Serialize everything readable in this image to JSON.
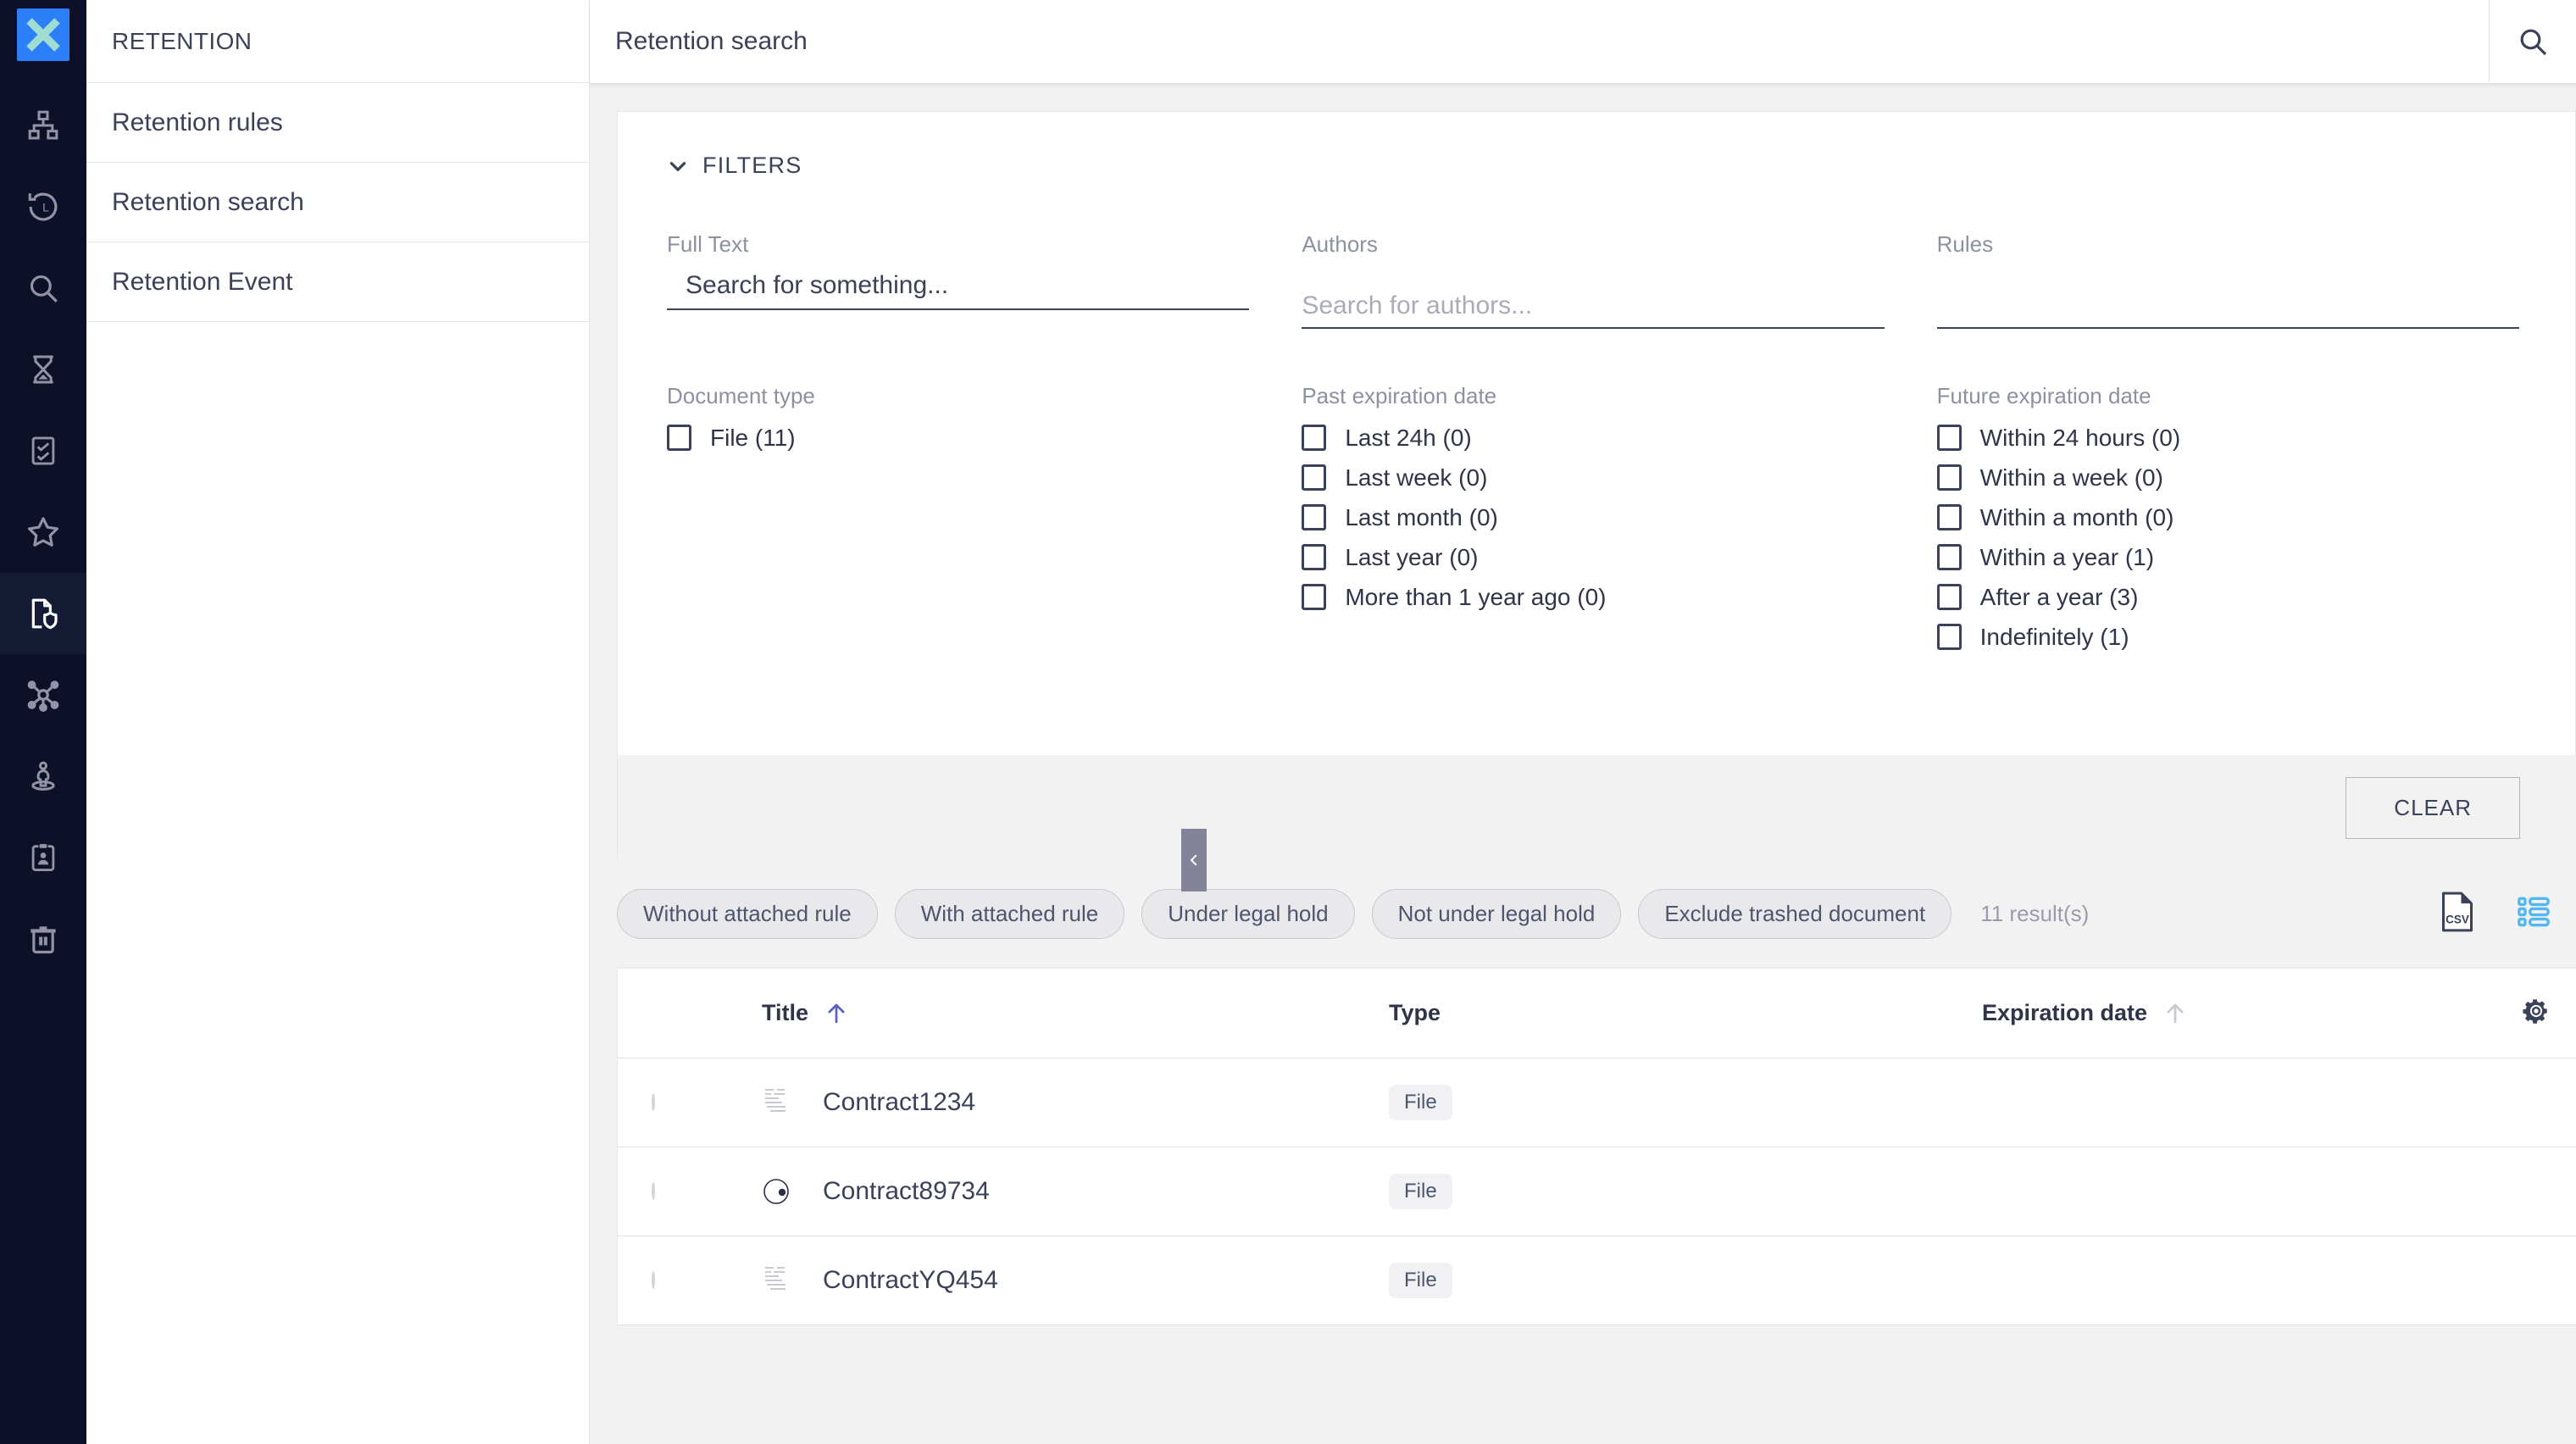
{
  "brand": {
    "logo_icon": "x-logo-icon",
    "logo_bg": "#2d7ff9",
    "logo_fg": "#9fdcd2"
  },
  "rail": {
    "items": [
      {
        "icon": "org-chart-icon",
        "active": false
      },
      {
        "icon": "history-clock-icon",
        "active": false
      },
      {
        "icon": "search-icon",
        "active": false
      },
      {
        "icon": "hourglass-icon",
        "active": false
      },
      {
        "icon": "checklist-icon",
        "active": false
      },
      {
        "icon": "star-icon",
        "active": false
      },
      {
        "icon": "document-shield-icon",
        "active": true
      },
      {
        "icon": "network-nodes-icon",
        "active": false
      },
      {
        "icon": "person-location-icon",
        "active": false
      },
      {
        "icon": "clipboard-person-icon",
        "active": false
      },
      {
        "icon": "trash-icon",
        "active": false
      }
    ]
  },
  "subnav": {
    "title": "RETENTION",
    "items": [
      {
        "label": "Retention rules"
      },
      {
        "label": "Retention search"
      },
      {
        "label": "Retention Event"
      }
    ]
  },
  "topbar": {
    "title": "Retention search",
    "search_icon": "search-icon"
  },
  "filters": {
    "header_label": "FILTERS",
    "chevron_icon": "chevron-down-icon",
    "full_text": {
      "label": "Full Text",
      "value": "",
      "placeholder": "Search for something..."
    },
    "authors": {
      "label": "Authors",
      "value": "",
      "placeholder": "Search for authors..."
    },
    "rules": {
      "label": "Rules",
      "value": "",
      "placeholder": ""
    },
    "document_type": {
      "title": "Document type",
      "options": [
        {
          "label": "File (11)",
          "checked": false
        }
      ]
    },
    "past_expiration": {
      "title": "Past expiration date",
      "options": [
        {
          "label": "Last 24h (0)",
          "checked": false
        },
        {
          "label": "Last week (0)",
          "checked": false
        },
        {
          "label": "Last month (0)",
          "checked": false
        },
        {
          "label": "Last year (0)",
          "checked": false
        },
        {
          "label": "More than 1 year ago (0)",
          "checked": false
        }
      ]
    },
    "future_expiration": {
      "title": "Future expiration date",
      "options": [
        {
          "label": "Within 24 hours (0)",
          "checked": false
        },
        {
          "label": "Within a week (0)",
          "checked": false
        },
        {
          "label": "Within a month (0)",
          "checked": false
        },
        {
          "label": "Within a year (1)",
          "checked": false
        },
        {
          "label": "After a year (3)",
          "checked": false
        },
        {
          "label": "Indefinitely (1)",
          "checked": false
        }
      ]
    },
    "clear_label": "CLEAR",
    "collapse_icon": "chevron-left-icon"
  },
  "quickfilters": {
    "pills": [
      {
        "label": "Without attached rule"
      },
      {
        "label": "With attached rule"
      },
      {
        "label": "Under legal hold"
      },
      {
        "label": "Not under legal hold"
      },
      {
        "label": "Exclude trashed document"
      }
    ],
    "result_count": "11 result(s)",
    "export_icon": "csv-file-icon",
    "export_icon_label": "CSV",
    "layout_icon": "list-layout-icon",
    "layout_icon_color": "#54b7f2"
  },
  "results_table": {
    "columns": [
      {
        "key": "title",
        "label": "Title",
        "sort": "asc",
        "sort_icon": "arrow-up-icon",
        "sort_active": true
      },
      {
        "key": "type",
        "label": "Type",
        "sort": "none"
      },
      {
        "key": "expiration",
        "label": "Expiration date",
        "sort": "none",
        "sort_icon": "arrow-up-icon",
        "sort_active": false
      }
    ],
    "settings_icon": "gear-icon",
    "rows": [
      {
        "title": "Contract1234",
        "thumb": "document-thumbnail",
        "type": "File",
        "expiration": ""
      },
      {
        "title": "Contract89734",
        "thumb": "circle-progress-thumbnail",
        "type": "File",
        "expiration": ""
      },
      {
        "title": "ContractYQ454",
        "thumb": "document-thumbnail",
        "type": "File",
        "expiration": ""
      }
    ]
  },
  "colors": {
    "rail_bg": "#0d1028",
    "accent_blue": "#2d7ff9",
    "sort_arrow": "#5b62c4",
    "text_dark": "#3b4159",
    "text_muted": "#8d90a1",
    "page_bg": "#f2f2f3"
  }
}
